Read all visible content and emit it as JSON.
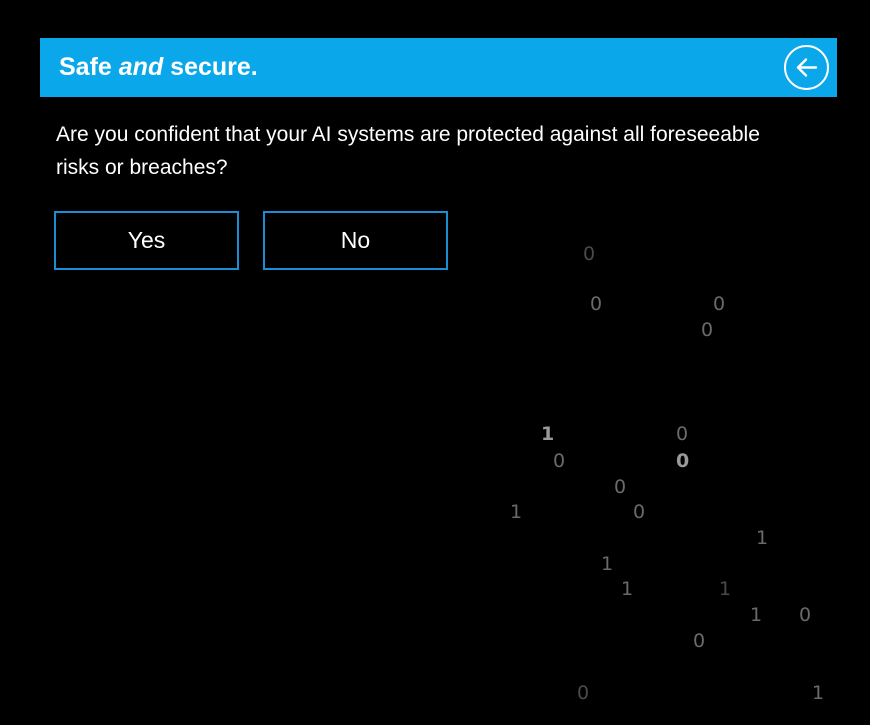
{
  "header": {
    "title_prefix": "Safe ",
    "title_emphasis": "and",
    "title_suffix": " secure.",
    "accent_color": "#0aa7ea",
    "back_icon": "arrow-left-circle-icon"
  },
  "question": {
    "text": "Are you confident that your AI systems are protected against all foreseeable risks or breaches?"
  },
  "answers": {
    "yes_label": "Yes",
    "no_label": "No",
    "border_color": "#1b8ed3"
  },
  "background_digits": [
    "0",
    "0",
    "0",
    "0",
    "1",
    "0",
    "0",
    "0",
    "0",
    "1",
    "0",
    "1",
    "1",
    "1",
    "1",
    "1",
    "0",
    "0",
    "0",
    "1"
  ]
}
